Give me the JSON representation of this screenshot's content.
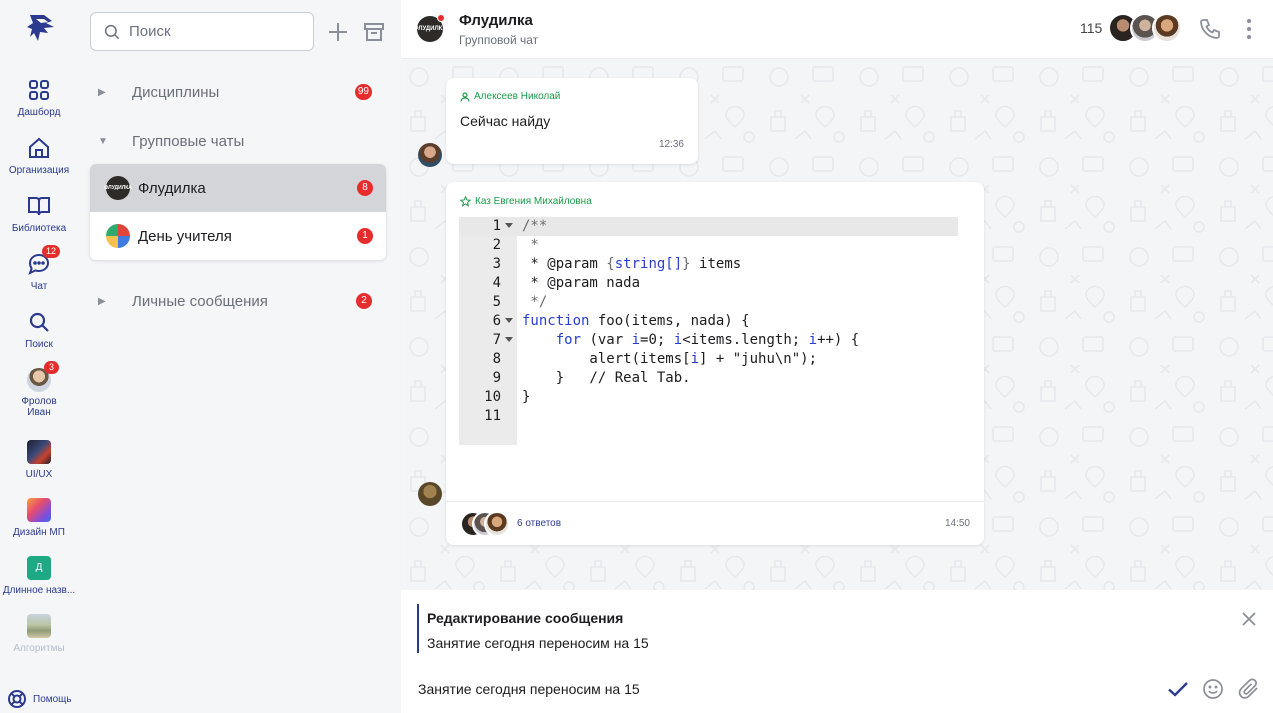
{
  "rail": {
    "items": [
      {
        "label": "Дашборд",
        "icon": "dashboard-icon"
      },
      {
        "label": "Организация",
        "icon": "home-icon"
      },
      {
        "label": "Библиотека",
        "icon": "book-icon"
      },
      {
        "label": "Чат",
        "icon": "chat-icon",
        "badge": "12"
      },
      {
        "label": "Поиск",
        "icon": "search-icon"
      },
      {
        "label": "Фролов Иван",
        "icon": "user-avatar",
        "badge": "3"
      },
      {
        "label": "UI/UX",
        "icon": "workspace-avatar"
      },
      {
        "label": "Дизайн МП",
        "icon": "workspace-avatar"
      },
      {
        "label": "Длинное назв...",
        "icon": "workspace-avatar",
        "initial": "Д"
      },
      {
        "label": "Алгоритмы",
        "icon": "workspace-avatar"
      }
    ],
    "help_label": "Помощь"
  },
  "sidebar": {
    "search_placeholder": "Поиск",
    "groups": [
      {
        "label": "Дисциплины",
        "badge": "99",
        "expanded": false
      },
      {
        "label": "Групповые чаты",
        "expanded": true
      },
      {
        "label": "Личные сообщения",
        "badge": "2",
        "expanded": false
      }
    ],
    "chats": [
      {
        "name": "Флудилка",
        "badge": "8",
        "active": true,
        "avatar_text": "ФЛУДИЛКА"
      },
      {
        "name": "День учителя",
        "badge": "1",
        "active": false
      }
    ]
  },
  "header": {
    "title": "Флудилка",
    "subtitle": "Групповой чат",
    "avatar_text": "ФЛУДИЛКА",
    "member_count": "115"
  },
  "messages": [
    {
      "author": "Алексеев Николай",
      "text": "Сейчас найду",
      "time": "12:36"
    },
    {
      "author": "Каз Евгения Михайловна",
      "time": "14:50",
      "replies": "6 ответов",
      "code_line_numbers": [
        "1",
        "2",
        "3",
        "4",
        "5",
        "6",
        "7",
        "8",
        "9",
        "10",
        "11"
      ]
    }
  ],
  "editing": {
    "title": "Редактирование сообщения",
    "original_text": "Занятие сегодня переносим на 15"
  },
  "composer": {
    "value": "Занятие сегодня переносим на 15"
  },
  "colors": {
    "accent": "#2b3a8f",
    "badge": "#e52d2d",
    "author_green": "#1a9c4a",
    "code_keyword": "#2a3fd0"
  }
}
